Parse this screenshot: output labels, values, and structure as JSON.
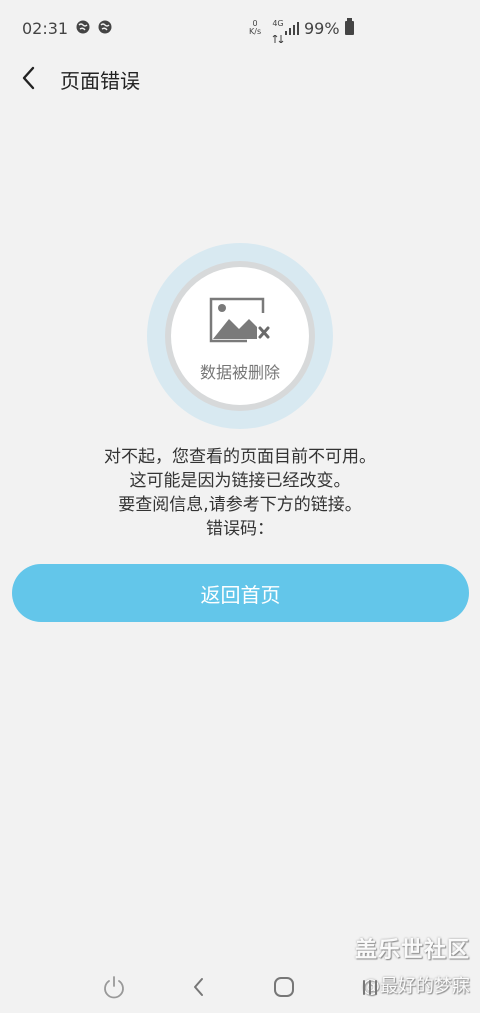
{
  "status_bar": {
    "time": "02:31",
    "net_speed_top": "0",
    "net_speed_unit": "K/s",
    "network_type": "4G",
    "battery": "99%",
    "icons": [
      "globe-icon",
      "globe-icon",
      "signal-icon",
      "battery-icon"
    ]
  },
  "header": {
    "title": "页面错误"
  },
  "error_graphic": {
    "caption": "数据被删除",
    "icon": "broken-image-icon"
  },
  "message": {
    "line1": "对不起，您查看的页面目前不可用。",
    "line2": "这可能是因为链接已经改变。",
    "line3": "要查阅信息,请参考下方的链接。",
    "line4": "错误码："
  },
  "actions": {
    "home_label": "返回首页"
  },
  "watermark": {
    "line1": "盖乐世社区",
    "line2": "@最好的梦寐"
  },
  "colors": {
    "accent": "#63c6ea",
    "background": "#f2f2f2",
    "ring": "#d8e9f1"
  },
  "nav_bar": {
    "icons": [
      "power-icon",
      "back-icon",
      "home-icon",
      "recents-icon"
    ]
  }
}
